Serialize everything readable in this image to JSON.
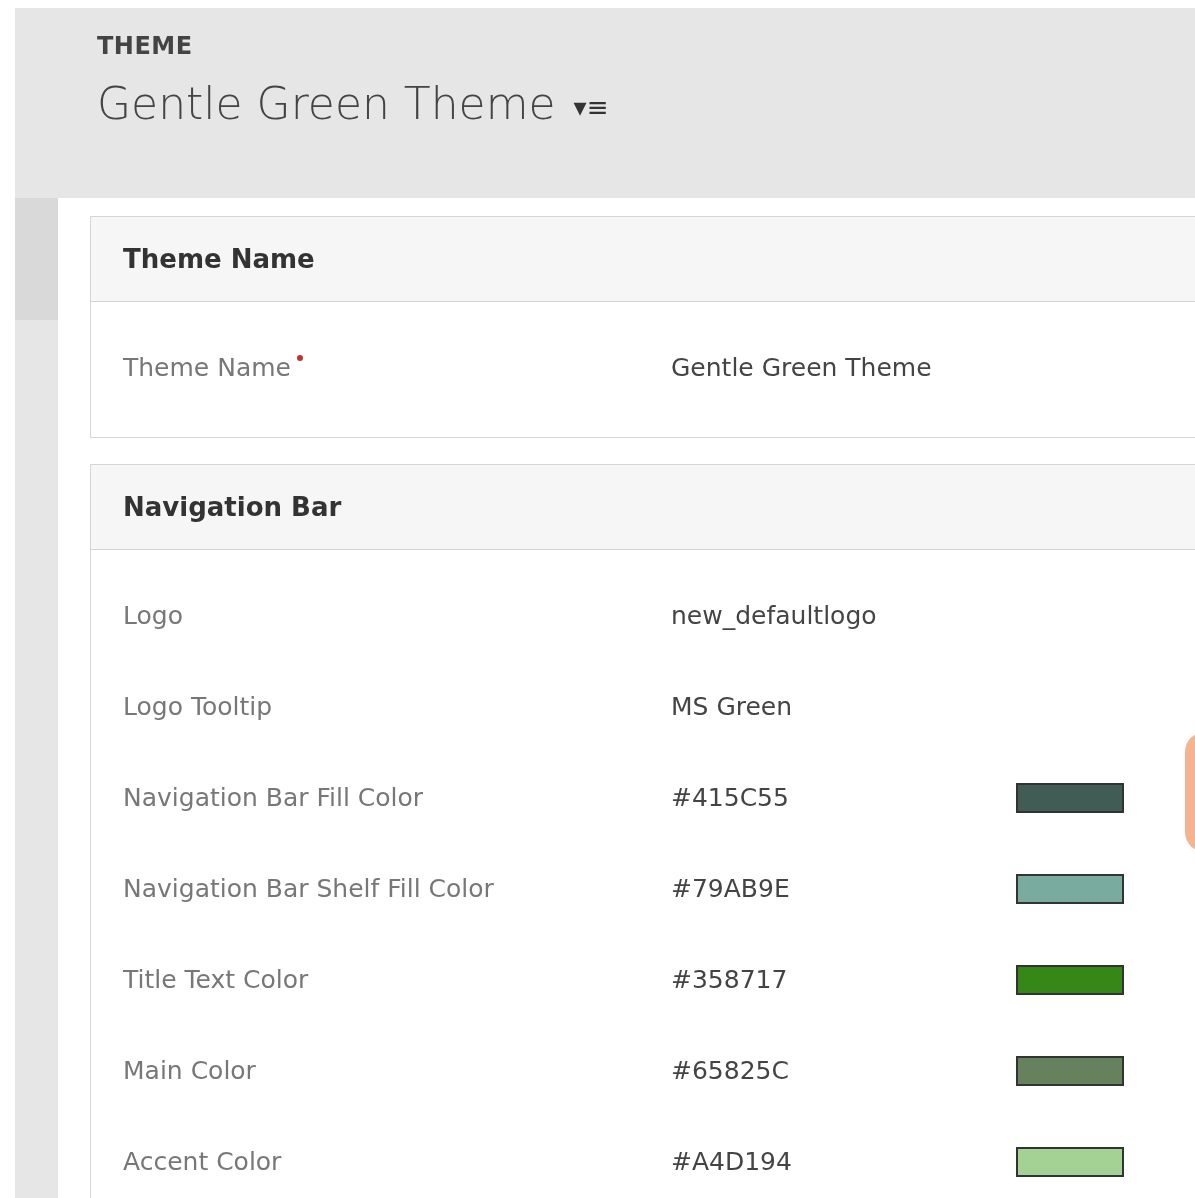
{
  "header": {
    "entity": "THEME",
    "title": "Gentle Green Theme",
    "menu_icon": "▾≡"
  },
  "sections": [
    {
      "title": "Theme Name",
      "fields": [
        {
          "kind": "text",
          "label": "Theme Name",
          "required": true,
          "value": "Gentle Green Theme"
        }
      ]
    },
    {
      "title": "Navigation Bar",
      "fields": [
        {
          "kind": "text",
          "label": "Logo",
          "required": false,
          "value": "new_defaultlogo"
        },
        {
          "kind": "text",
          "label": "Logo Tooltip",
          "required": false,
          "value": "MS Green"
        },
        {
          "kind": "color",
          "label": "Navigation Bar Fill Color",
          "required": false,
          "value": "#415C55",
          "color": "#415c55"
        },
        {
          "kind": "color",
          "label": "Navigation Bar Shelf Fill Color",
          "required": false,
          "value": "#79AB9E",
          "color": "#79ab9e"
        },
        {
          "kind": "color",
          "label": "Title Text Color",
          "required": false,
          "value": "#358717",
          "color": "#358717"
        },
        {
          "kind": "color",
          "label": "Main Color",
          "required": false,
          "value": "#65825C",
          "color": "#65825c"
        },
        {
          "kind": "color",
          "label": "Accent Color",
          "required": false,
          "value": "#A4D194",
          "color": "#a4d194"
        }
      ]
    }
  ]
}
